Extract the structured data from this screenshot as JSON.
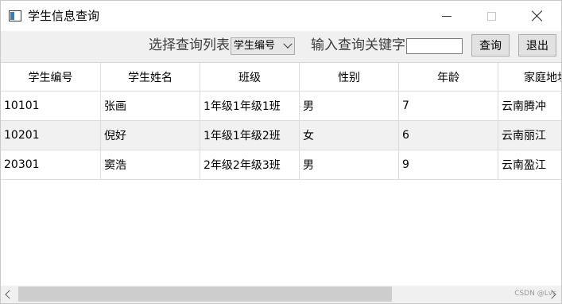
{
  "window": {
    "title": "学生信息查询",
    "icon": "app-window-icon"
  },
  "toolbar": {
    "select_column_label": "选择查询列表",
    "selected_column": "学生编号",
    "keyword_label": "输入查询关键字",
    "keyword_value": "",
    "query_button": "查询",
    "exit_button": "退出"
  },
  "table": {
    "columns": [
      "学生编号",
      "学生姓名",
      "班级",
      "性别",
      "年龄",
      "家庭地址"
    ],
    "rows": [
      [
        "10101",
        "张画",
        "1年级1年级1班",
        "男",
        "7",
        "云南腾冲"
      ],
      [
        "10201",
        "倪好",
        "1年级1年级2班",
        "女",
        "6",
        "云南丽江"
      ],
      [
        "20301",
        "窦浩",
        "2年级2年级3班",
        "男",
        "9",
        "云南盈江"
      ]
    ]
  },
  "watermark": "CSDN @Lvc"
}
